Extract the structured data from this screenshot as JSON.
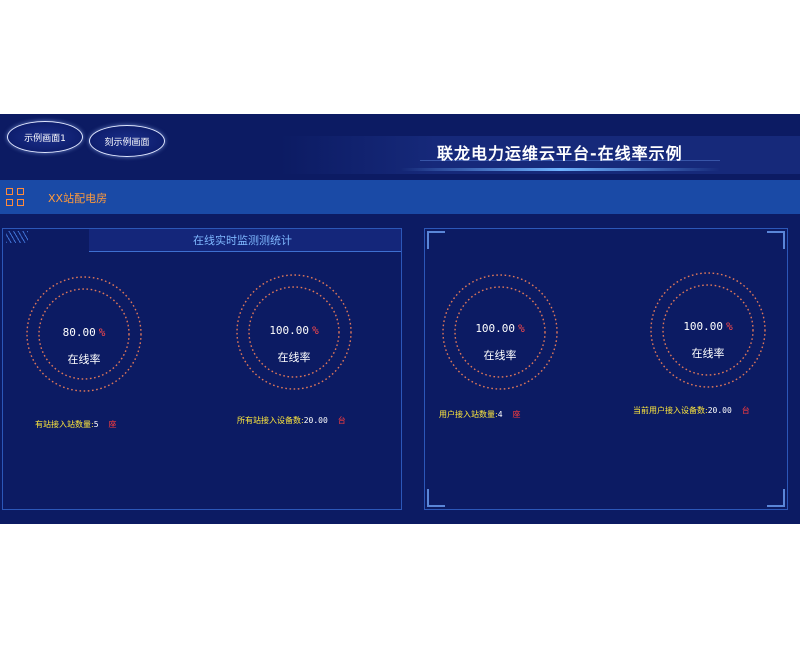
{
  "nav": {
    "btn1": "示例画面1",
    "btn2": "刻示例画面"
  },
  "header": {
    "title": "联龙电力运维云平台-在线率示例"
  },
  "station": {
    "name": "XX站配电房"
  },
  "panel_left": {
    "title": "在线实时监测测统计"
  },
  "gauges": [
    {
      "value": "80.00",
      "unit": "%",
      "label": "在线率"
    },
    {
      "value": "100.00",
      "unit": "%",
      "label": "在线率"
    },
    {
      "value": "100.00",
      "unit": "%",
      "label": "在线率"
    },
    {
      "value": "100.00",
      "unit": "%",
      "label": "在线率"
    }
  ],
  "stats": [
    {
      "label": "有站接入站数量:",
      "value": "5",
      "unit": "座"
    },
    {
      "label": "所有站接入设备数:",
      "value": "20.00",
      "unit": "台"
    },
    {
      "label": "用户接入站数量:",
      "value": "4",
      "unit": "座"
    },
    {
      "label": "当前用户接入设备数:",
      "value": "20.00",
      "unit": "台"
    }
  ],
  "colors": {
    "background": "#0c1b63",
    "station_bar": "#1a4aa6",
    "accent_orange": "#ff9a3c",
    "gauge_ring": "#e0785a",
    "stat_label": "#ffe83c",
    "unit_red": "#ff3c3c"
  },
  "icons": {
    "station": "grid-icon"
  }
}
